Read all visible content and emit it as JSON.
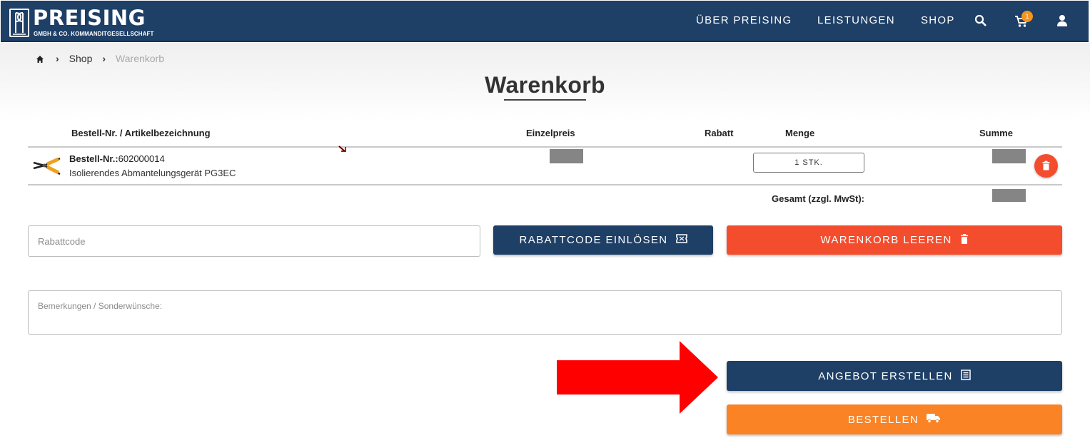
{
  "header": {
    "logo_title": "PREISING",
    "logo_subtitle": "GMBH & CO. KOMMANDITGESELLSCHAFT",
    "nav": [
      "ÜBER PREISING",
      "LEISTUNGEN",
      "SHOP"
    ],
    "cart_count": "1",
    "icons": [
      "search-icon",
      "cart-icon",
      "user-icon"
    ]
  },
  "breadcrumb": {
    "items": [
      "Shop"
    ],
    "current": "Warenkorb"
  },
  "page_title": "Warenkorb",
  "table": {
    "columns": {
      "article": "Bestell-Nr. / Artikelbezeichnung",
      "unit_price": "Einzelpreis",
      "discount": "Rabatt",
      "quantity": "Menge",
      "sum": "Summe"
    },
    "rows": [
      {
        "order_nr_label": "Bestell-Nr.:",
        "order_nr": "602000014",
        "name": "Isolierendes Abmantelungsgerät PG3EC",
        "quantity": "1 STK."
      }
    ],
    "total_label": "Gesamt (zzgl. MwSt):"
  },
  "coupon": {
    "placeholder": "Rabattcode",
    "redeem_label": "RABATTCODE EINLÖSEN"
  },
  "clear_cart_label": "WARENKORB LEEREN",
  "remarks": {
    "placeholder": "Bemerkungen / Sonderwünsche:"
  },
  "offer_label": "ANGEBOT ERSTELLEN",
  "order_label": "BESTELLEN",
  "colors": {
    "navy": "#1e3f66",
    "red": "#f44d2e",
    "orange": "#f98325",
    "badge": "#f7941d",
    "annotation_arrow": "#ff0000"
  }
}
